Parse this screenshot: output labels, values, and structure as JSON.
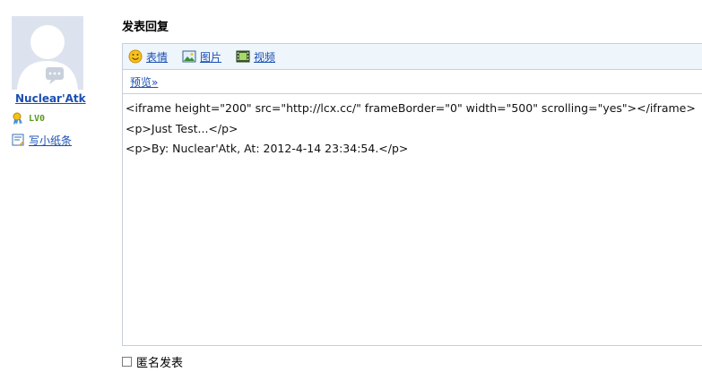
{
  "user": {
    "name": "Nuclear'Atk",
    "level": "LV0",
    "pm_label": "写小纸条"
  },
  "reply": {
    "title": "发表回复",
    "toolbar": {
      "emoji_label": "表情",
      "image_label": "图片",
      "video_label": "视频"
    },
    "preview_label": "预览»",
    "content_lines": [
      "<iframe height=\"200\" src=\"http://lcx.cc/\" frameBorder=\"0\" width=\"500\" scrolling=\"yes\"></iframe>",
      "<p>Just Test...</p>",
      "<p>By: Nuclear'Atk, At: 2012-4-14 23:34:54.</p>"
    ],
    "anonymous_label": "匿名发表",
    "anonymous_checked": false
  },
  "colors": {
    "link": "#1b4fb3",
    "toolbar_bg": "#eef5fb",
    "border": "#c7cfd9",
    "level_green": "#5a9b1b"
  },
  "icons": {
    "avatar": "default-avatar-icon",
    "level": "medal-icon",
    "pm": "note-icon",
    "emoji": "smiley-icon",
    "image": "picture-icon",
    "video": "film-icon"
  }
}
